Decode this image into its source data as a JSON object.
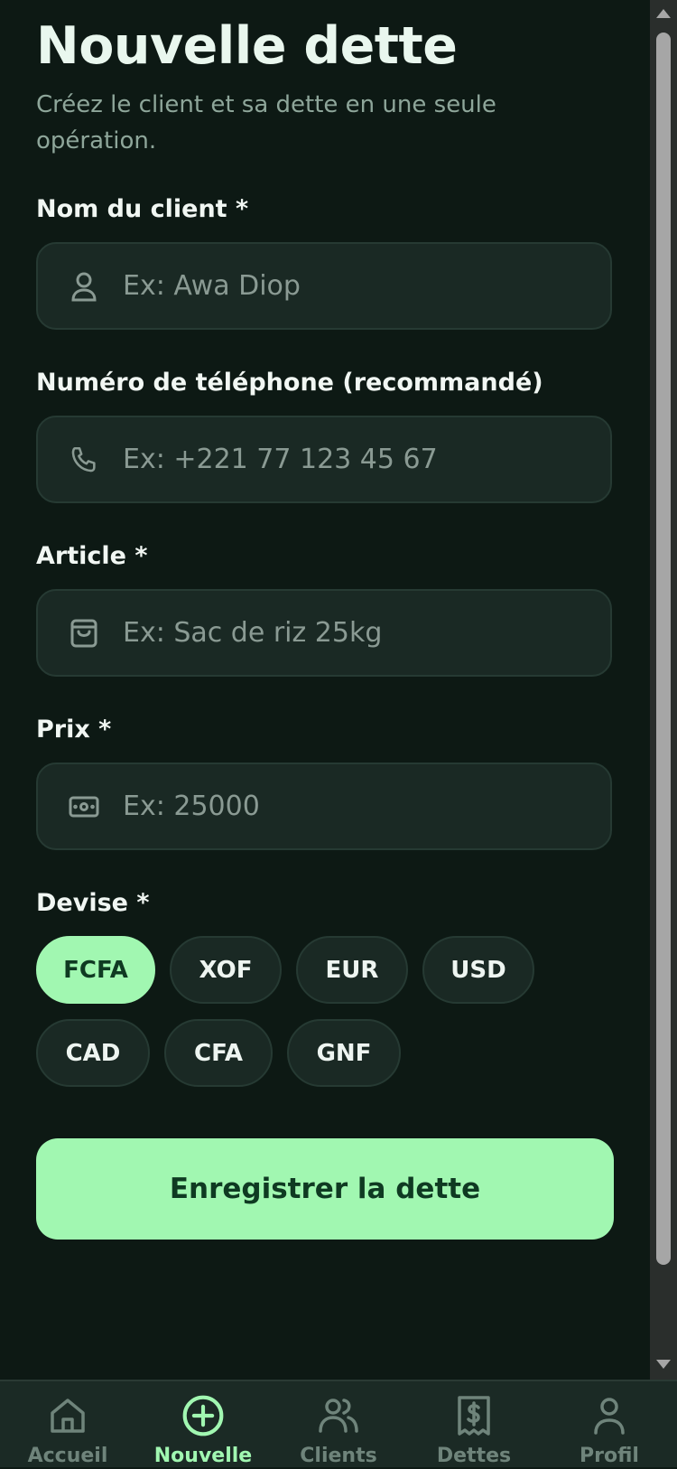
{
  "header": {
    "title": "Nouvelle dette",
    "subtitle": "Créez le client et sa dette en une seule opération."
  },
  "form": {
    "client_name": {
      "label": "Nom du client *",
      "placeholder": "Ex: Awa Diop",
      "value": ""
    },
    "phone": {
      "label": "Numéro de téléphone (recommandé)",
      "placeholder": "Ex: +221 77 123 45 67",
      "value": ""
    },
    "article": {
      "label": "Article *",
      "placeholder": "Ex: Sac de riz 25kg",
      "value": ""
    },
    "price": {
      "label": "Prix *",
      "placeholder": "Ex: 25000",
      "value": ""
    },
    "currency": {
      "label": "Devise *",
      "selected": "FCFA",
      "options": [
        "FCFA",
        "XOF",
        "EUR",
        "USD",
        "CAD",
        "CFA",
        "GNF"
      ]
    },
    "submit_label": "Enregistrer la dette"
  },
  "bottom_nav": {
    "active": "Nouvelle",
    "items": [
      {
        "label": "Accueil",
        "icon": "home-icon"
      },
      {
        "label": "Nouvelle",
        "icon": "plus-circle-icon"
      },
      {
        "label": "Clients",
        "icon": "users-icon"
      },
      {
        "label": "Dettes",
        "icon": "receipt-icon"
      },
      {
        "label": "Profil",
        "icon": "user-icon"
      }
    ]
  },
  "colors": {
    "background": "#0d1914",
    "accent": "#a1f7b1",
    "field_bg": "#1a2924",
    "nav_bg": "#1b2a25"
  }
}
